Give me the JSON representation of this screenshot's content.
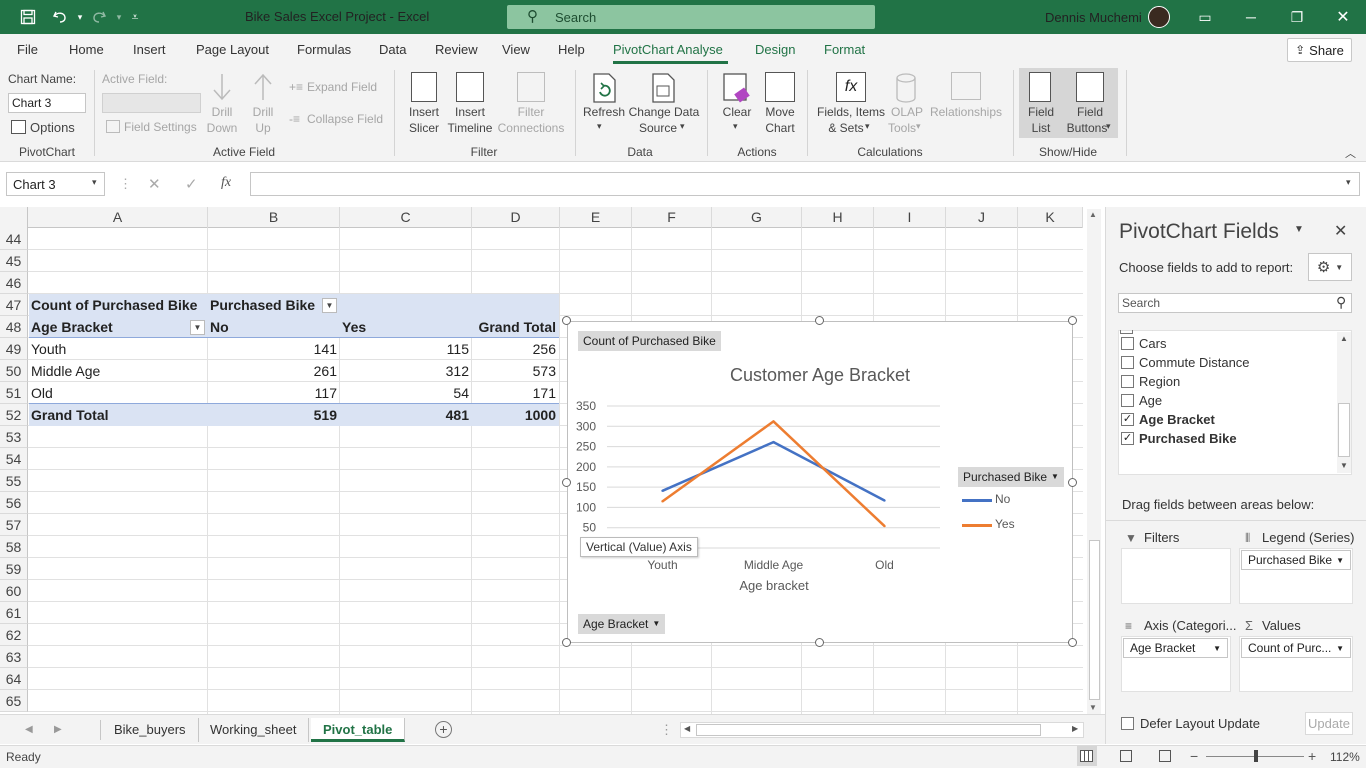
{
  "titlebar": {
    "title": "Bike Sales Excel Project  -  Excel",
    "search_placeholder": "Search",
    "user": "Dennis Muchemi"
  },
  "menu": [
    "File",
    "Home",
    "Insert",
    "Page Layout",
    "Formulas",
    "Data",
    "Review",
    "View",
    "Help",
    "PivotChart Analyse",
    "Design",
    "Format"
  ],
  "share_label": "Share",
  "ribbon": {
    "pivotchart": {
      "chart_name_label": "Chart Name:",
      "chart_name_value": "Chart 3",
      "options_label": "Options",
      "group": "PivotChart"
    },
    "active_field": {
      "label": "Active Field:",
      "field_settings": "Field Settings",
      "drill_down_1": "Drill",
      "drill_down_2": "Down",
      "drill_up_1": "Drill",
      "drill_up_2": "Up",
      "expand": "Expand Field",
      "collapse": "Collapse Field",
      "group": "Active Field"
    },
    "filter": {
      "slicer_1": "Insert",
      "slicer_2": "Slicer",
      "timeline_1": "Insert",
      "timeline_2": "Timeline",
      "conn_1": "Filter",
      "conn_2": "Connections",
      "group": "Filter"
    },
    "data": {
      "refresh": "Refresh",
      "change_1": "Change Data",
      "change_2": "Source",
      "group": "Data"
    },
    "actions": {
      "clear": "Clear",
      "move_1": "Move",
      "move_2": "Chart",
      "group": "Actions"
    },
    "calculations": {
      "fields_1": "Fields, Items",
      "fields_2": "& Sets",
      "olap_1": "OLAP",
      "olap_2": "Tools",
      "relationships": "Relationships",
      "group": "Calculations"
    },
    "showhide": {
      "field_list_1": "Field",
      "field_list_2": "List",
      "field_buttons_1": "Field",
      "field_buttons_2": "Buttons",
      "group": "Show/Hide"
    }
  },
  "formula": {
    "name_box": "Chart 3",
    "fx": "fx",
    "value": ""
  },
  "columns": [
    "A",
    "B",
    "C",
    "D",
    "E",
    "F",
    "G",
    "H",
    "I",
    "J",
    "K"
  ],
  "rows": [
    "44",
    "45",
    "46",
    "47",
    "48",
    "49",
    "50",
    "51",
    "52",
    "53",
    "54",
    "55",
    "56",
    "57",
    "58",
    "59",
    "60",
    "61",
    "62",
    "63",
    "64",
    "65"
  ],
  "pivot": {
    "title_a": "Count of Purchased Bike",
    "title_b": "Purchased Bike",
    "head_a": "Age Bracket",
    "head_b": "No",
    "head_c": "Yes",
    "head_d": "Grand Total",
    "r1": [
      "Youth",
      "141",
      "115",
      "256"
    ],
    "r2": [
      "Middle Age",
      "261",
      "312",
      "573"
    ],
    "r3": [
      "Old",
      "117",
      "54",
      "171"
    ],
    "total": [
      "Grand Total",
      "519",
      "481",
      "1000"
    ]
  },
  "chart_data": {
    "type": "line",
    "title": "Customer Age Bracket",
    "value_button": "Count of Purchased Bike",
    "legend_button": "Purchased Bike",
    "axis_button": "Age Bracket",
    "xlabel": "Age bracket",
    "tooltip": "Vertical (Value) Axis",
    "categories": [
      "Youth",
      "Middle Age",
      "Old"
    ],
    "series": [
      {
        "name": "No",
        "values": [
          141,
          261,
          117
        ],
        "color": "#4472c4"
      },
      {
        "name": "Yes",
        "values": [
          115,
          312,
          54
        ],
        "color": "#ed7d31"
      }
    ],
    "yticks": [
      "350",
      "300",
      "250",
      "200",
      "150",
      "100",
      "50"
    ],
    "ylim": [
      0,
      350
    ],
    "legend_position": "right",
    "grid": true
  },
  "pane": {
    "title": "PivotChart Fields",
    "subtitle": "Choose fields to add to report:",
    "search_placeholder": "Search",
    "fields": [
      {
        "name": "Cars",
        "checked": false
      },
      {
        "name": "Commute Distance",
        "checked": false
      },
      {
        "name": "Region",
        "checked": false
      },
      {
        "name": "Age",
        "checked": false
      },
      {
        "name": "Age Bracket",
        "checked": true
      },
      {
        "name": "Purchased Bike",
        "checked": true
      }
    ],
    "drag_label": "Drag fields between areas below:",
    "filters": "Filters",
    "legend": "Legend (Series)",
    "legend_value": "Purchased Bike",
    "axis": "Axis (Categori...",
    "axis_value": "Age Bracket",
    "values": "Values",
    "values_value": "Count of Purc...",
    "defer": "Defer Layout Update",
    "update": "Update"
  },
  "sheets": [
    "Bike_buyers",
    "Working_sheet",
    "Pivot_table"
  ],
  "status": {
    "ready": "Ready",
    "zoom": "112%"
  }
}
